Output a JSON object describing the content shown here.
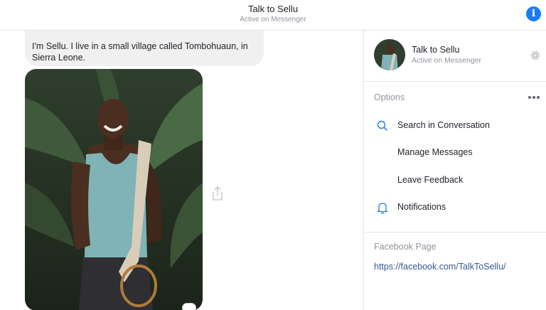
{
  "header": {
    "title": "Talk to Sellu",
    "status": "Active on Messenger",
    "info_icon": "info-icon"
  },
  "chat": {
    "message_text": "I'm Sellu. I live in a small village called Tombohuaun, in Sierra Leone.",
    "photo_icon": "photo-of-sellu",
    "share_icon": "share-icon"
  },
  "panel": {
    "name": "Talk to Sellu",
    "status": "Active on Messenger",
    "options_label": "Options",
    "options": [
      {
        "label": "Search in Conversation",
        "icon": "search-icon"
      },
      {
        "label": "Manage Messages",
        "icon": ""
      },
      {
        "label": "Leave Feedback",
        "icon": ""
      },
      {
        "label": "Notifications",
        "icon": "bell-icon"
      }
    ],
    "facebook_label": "Facebook Page",
    "facebook_link": "https://facebook.com/TalkToSellu/"
  },
  "colors": {
    "accent": "#1a7cf2",
    "link": "#365899",
    "muted": "#90949c",
    "bubble": "#f1f0f0"
  }
}
